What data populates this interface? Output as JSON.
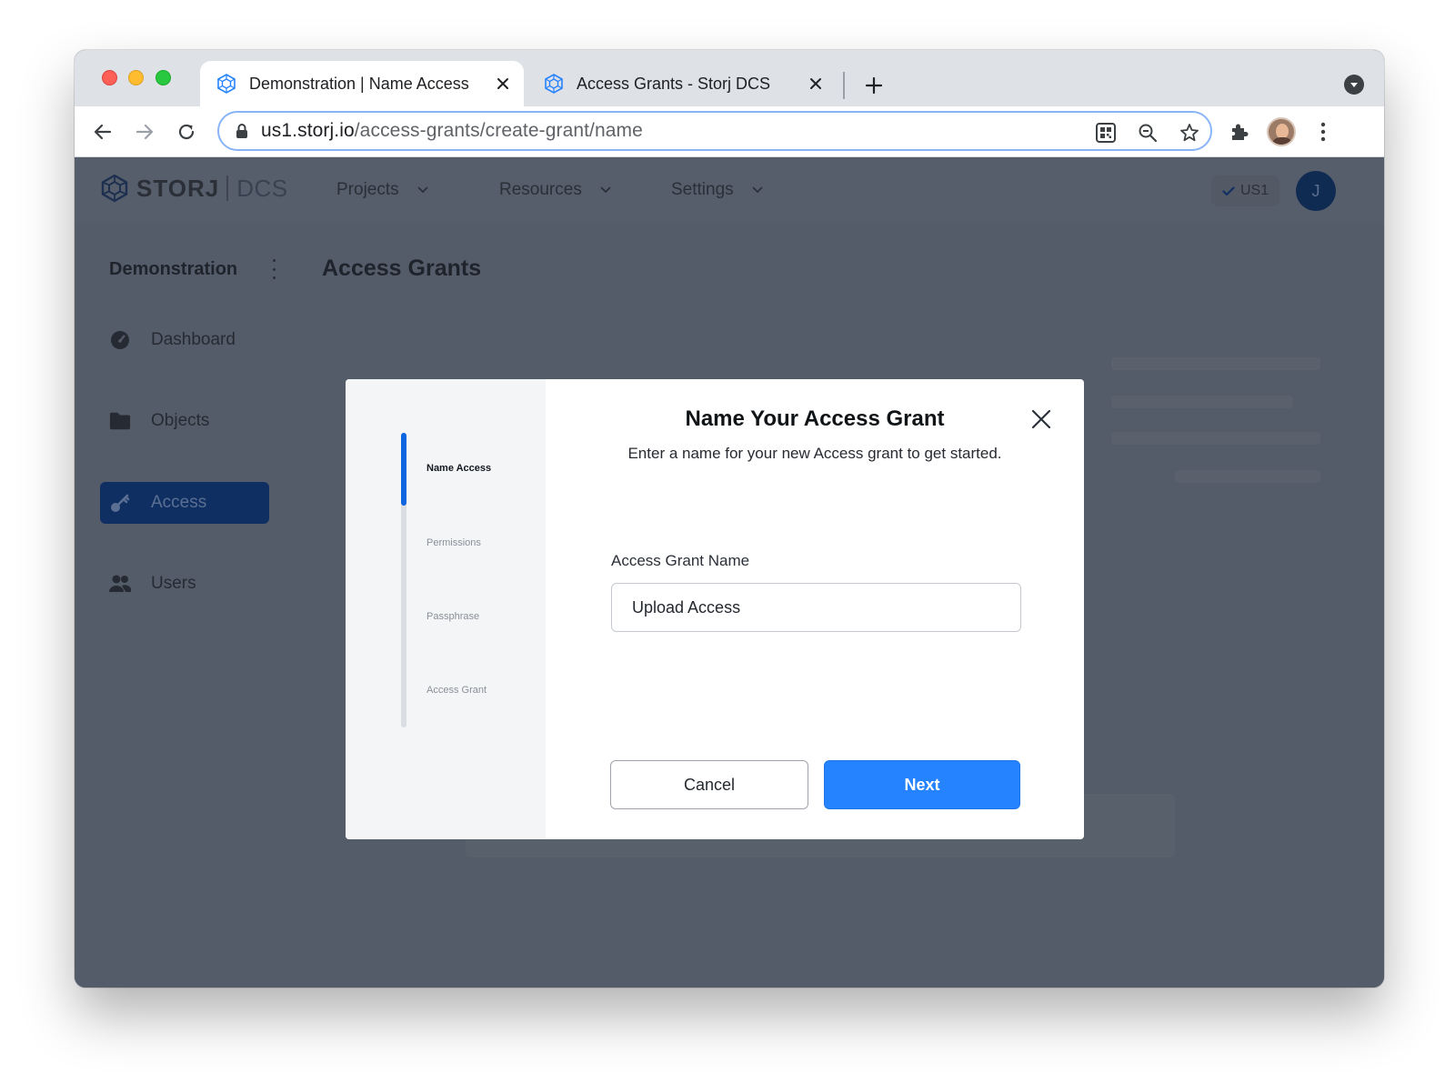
{
  "browser": {
    "tabs": [
      {
        "title": "Demonstration | Name Access",
        "icon": "storj-favicon-icon",
        "active": true
      },
      {
        "title": "Access Grants - Storj DCS",
        "icon": "storj-favicon-icon",
        "active": false
      }
    ],
    "address_bar": {
      "host": "us1.storj.io",
      "path": "/access-grants/create-grant/name"
    }
  },
  "header": {
    "brand_name": "STORJ",
    "brand_product": "DCS",
    "nav": [
      {
        "label": "Projects"
      },
      {
        "label": "Resources"
      },
      {
        "label": "Settings"
      }
    ],
    "region": "US1",
    "user_initial": "J"
  },
  "sidebar": {
    "project_name": "Demonstration",
    "items": [
      {
        "label": "Dashboard",
        "icon": "dashboard-gauge-icon"
      },
      {
        "label": "Objects",
        "icon": "folder-icon"
      },
      {
        "label": "Access",
        "icon": "key-icon",
        "active": true
      },
      {
        "label": "Users",
        "icon": "users-icon"
      }
    ]
  },
  "main": {
    "title": "Access Grants"
  },
  "modal": {
    "title": "Name Your Access Grant",
    "subtitle": "Enter a name for your new Access grant to get started.",
    "steps": [
      {
        "label": "Name Access",
        "active": true
      },
      {
        "label": "Permissions",
        "active": false
      },
      {
        "label": "Passphrase",
        "active": false
      },
      {
        "label": "Access Grant",
        "active": false
      }
    ],
    "field_label": "Access Grant Name",
    "field_value": "Upload Access",
    "cancel_label": "Cancel",
    "next_label": "Next"
  },
  "colors": {
    "primary_button": "#2683ff",
    "active_step": "#0d66e0",
    "sidebar_active": "#0f2f62",
    "overlay_background": "#555c69"
  }
}
